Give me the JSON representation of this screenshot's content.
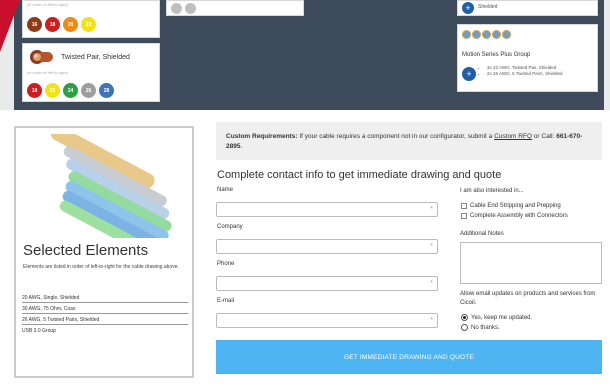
{
  "cards": {
    "top_left_cable": {
      "tiny_label": "(in order of left-to-right)",
      "dots": [
        {
          "label": "16",
          "color": "#8b3a1a"
        },
        {
          "label": "18",
          "color": "#cc1f1f"
        },
        {
          "label": "20",
          "color": "#f08a12"
        },
        {
          "label": "22",
          "color": "#f2e21c"
        }
      ]
    },
    "twisted_pair": {
      "title": "Twisted Pair, Shielded",
      "tiny_label": "(in order of left-to-right)",
      "dots": [
        {
          "label": "18",
          "color": "#cc1f1f"
        },
        {
          "label": "22",
          "color": "#f2e21c"
        },
        {
          "label": "24",
          "color": "#2f9e44"
        },
        {
          "label": "26",
          "color": "#9e9e9e"
        },
        {
          "label": "28",
          "color": "#3e74b8"
        }
      ]
    },
    "top_right_shielded": {
      "label": "Shielded"
    },
    "motion_series": {
      "title": "Motion Series Plus Group",
      "items": [
        "3x 22 AWG, Twisted Pair, Shielded",
        "2x 26 AWG, 5 Twisted Pairs, Shielded"
      ],
      "add_icon": "plus-icon"
    }
  },
  "selected": {
    "title": "Selected Elements",
    "description": "Elements are listed in order of left-to-right for the cable drawing above.",
    "items": [
      "20 AWG, Single, Shielded",
      "30 AWG, 75 Ohm, Coax",
      "26 AWG, 5 Twisted Pairs, Shielded",
      "USB 3.0 Group"
    ]
  },
  "custom": {
    "bold": "Custom Requirements:",
    "text": " If your cable requires a component not in our configurator, submit a ",
    "link": "Custom RFQ",
    "after": " or Call: ",
    "phone": "661-670-2895",
    "end": "."
  },
  "form": {
    "title": "Complete contact info to get immediate drawing and quote",
    "fields": [
      {
        "label": "Name"
      },
      {
        "label": "Company"
      },
      {
        "label": "Phone"
      },
      {
        "label": "E-mail"
      }
    ],
    "required_mark": "*",
    "interest_title": "I am also interested in...",
    "interests": [
      "Cable End Stripping and Prepping",
      "Complete Assembly with Connectors"
    ],
    "notes_label": "Additional Notes",
    "email_updates": "Allow email updates on products and services from Cicoil.",
    "radio_yes": "Yes, keep me updated.",
    "radio_no": "No thanks.",
    "submit": "GET IMMEDIATE DRAWING AND QUOTE"
  },
  "colors": {
    "band": "#3e4b5a",
    "accent": "#4fb4f2",
    "red": "#c8102e"
  }
}
